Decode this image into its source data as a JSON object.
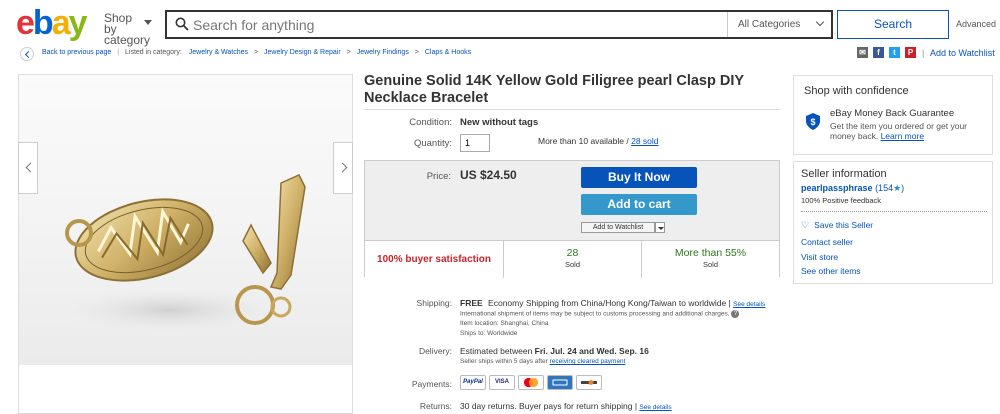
{
  "header": {
    "logo": {
      "e": "e",
      "b": "b",
      "a": "a",
      "y": "y"
    },
    "shop_by_category": "Shop by category",
    "search_placeholder": "Search for anything",
    "category_select": "All Categories",
    "search_button": "Search",
    "advanced": "Advanced"
  },
  "breadcrumb": {
    "back": "Back to previous page",
    "listed_in": "Listed in category:",
    "items": [
      "Jewelry & Watches",
      "Jewelry Design & Repair",
      "Jewelry Findings",
      "Claps & Hooks"
    ],
    "sep": ">"
  },
  "share": {
    "icons": [
      "email-icon",
      "facebook-icon",
      "twitter-icon",
      "pinterest-icon"
    ],
    "watchlist": "Add to Watchlist"
  },
  "listing": {
    "title": "Genuine Solid 14K Yellow Gold Filigree pearl Clasp DIY Necklace Bracelet",
    "condition_label": "Condition:",
    "condition_value": "New without tags",
    "quantity_label": "Quantity:",
    "quantity_value": "1",
    "availability": "More than 10 available /",
    "sold_link": "28 sold",
    "price_label": "Price:",
    "price": "US $24.50",
    "buy_now": "Buy It Now",
    "add_to_cart": "Add to cart",
    "add_to_watchlist": "Add to Watchlist",
    "stats": {
      "satisfaction": "100% buyer satisfaction",
      "sold_num": "28",
      "sold_label": "Sold",
      "more_than": "More than 55%",
      "more_label": "Sold"
    },
    "shipping_label": "Shipping:",
    "shipping_free": "FREE",
    "shipping_text": "Economy Shipping from China/Hong Kong/Taiwan to worldwide |",
    "see_details": "See details",
    "shipping_note": "International shipment of items may be subject to customs processing and additional charges.",
    "item_location": "Item location:  Shanghai, China",
    "ships_to": "Ships to:  Worldwide",
    "delivery_label": "Delivery:",
    "delivery_prefix": "Estimated between",
    "delivery_dates": "Fri. Jul. 24 and Wed. Sep. 16",
    "seller_ships": "Seller ships within 5 days after",
    "seller_ships_link": "receiving cleared payment",
    "payments_label": "Payments:",
    "payment_icons": [
      "PayPal",
      "VISA",
      "MasterCard",
      "AMEX",
      "DISCOVER"
    ],
    "returns_label": "Returns:",
    "returns_text": "30 day returns. Buyer pays for return shipping |",
    "returns_see_details": "See details"
  },
  "confidence": {
    "title": "Shop with confidence",
    "mbg_title": "eBay Money Back Guarantee",
    "mbg_text": "Get the item you ordered or get your money back.",
    "learn_more": "Learn more"
  },
  "seller": {
    "title": "Seller information",
    "name": "pearlpassphrase",
    "score": "(154",
    "score_close": ")",
    "feedback": "100% Positive feedback",
    "save": "Save this Seller",
    "contact": "Contact seller",
    "visit": "Visit store",
    "other": "See other items"
  },
  "colors": {
    "link": "#0654ba",
    "buy_now": "#0654ba",
    "add_to_cart": "#3498ca",
    "satisfaction": "#c7242a",
    "stat_green": "#2b7a1b"
  }
}
